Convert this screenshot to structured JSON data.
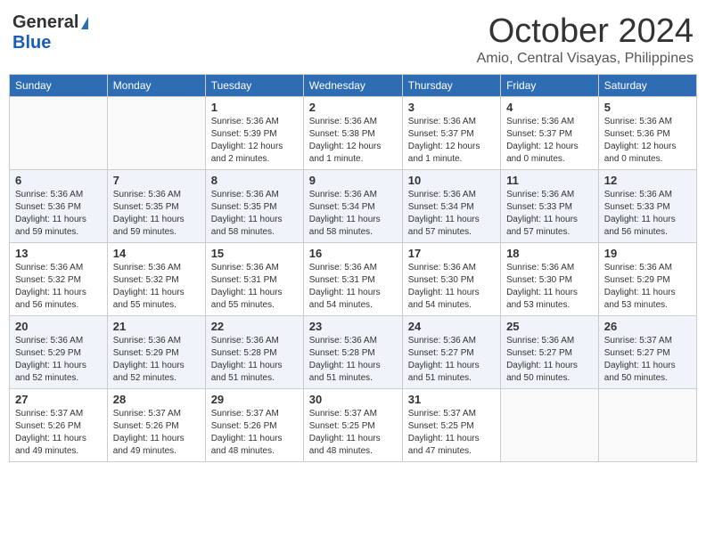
{
  "header": {
    "logo_general": "General",
    "logo_blue": "Blue",
    "month": "October 2024",
    "location": "Amio, Central Visayas, Philippines"
  },
  "days_of_week": [
    "Sunday",
    "Monday",
    "Tuesday",
    "Wednesday",
    "Thursday",
    "Friday",
    "Saturday"
  ],
  "weeks": [
    [
      {
        "day": "",
        "sunrise": "",
        "sunset": "",
        "daylight": ""
      },
      {
        "day": "",
        "sunrise": "",
        "sunset": "",
        "daylight": ""
      },
      {
        "day": "1",
        "sunrise": "Sunrise: 5:36 AM",
        "sunset": "Sunset: 5:39 PM",
        "daylight": "Daylight: 12 hours and 2 minutes."
      },
      {
        "day": "2",
        "sunrise": "Sunrise: 5:36 AM",
        "sunset": "Sunset: 5:38 PM",
        "daylight": "Daylight: 12 hours and 1 minute."
      },
      {
        "day": "3",
        "sunrise": "Sunrise: 5:36 AM",
        "sunset": "Sunset: 5:37 PM",
        "daylight": "Daylight: 12 hours and 1 minute."
      },
      {
        "day": "4",
        "sunrise": "Sunrise: 5:36 AM",
        "sunset": "Sunset: 5:37 PM",
        "daylight": "Daylight: 12 hours and 0 minutes."
      },
      {
        "day": "5",
        "sunrise": "Sunrise: 5:36 AM",
        "sunset": "Sunset: 5:36 PM",
        "daylight": "Daylight: 12 hours and 0 minutes."
      }
    ],
    [
      {
        "day": "6",
        "sunrise": "Sunrise: 5:36 AM",
        "sunset": "Sunset: 5:36 PM",
        "daylight": "Daylight: 11 hours and 59 minutes."
      },
      {
        "day": "7",
        "sunrise": "Sunrise: 5:36 AM",
        "sunset": "Sunset: 5:35 PM",
        "daylight": "Daylight: 11 hours and 59 minutes."
      },
      {
        "day": "8",
        "sunrise": "Sunrise: 5:36 AM",
        "sunset": "Sunset: 5:35 PM",
        "daylight": "Daylight: 11 hours and 58 minutes."
      },
      {
        "day": "9",
        "sunrise": "Sunrise: 5:36 AM",
        "sunset": "Sunset: 5:34 PM",
        "daylight": "Daylight: 11 hours and 58 minutes."
      },
      {
        "day": "10",
        "sunrise": "Sunrise: 5:36 AM",
        "sunset": "Sunset: 5:34 PM",
        "daylight": "Daylight: 11 hours and 57 minutes."
      },
      {
        "day": "11",
        "sunrise": "Sunrise: 5:36 AM",
        "sunset": "Sunset: 5:33 PM",
        "daylight": "Daylight: 11 hours and 57 minutes."
      },
      {
        "day": "12",
        "sunrise": "Sunrise: 5:36 AM",
        "sunset": "Sunset: 5:33 PM",
        "daylight": "Daylight: 11 hours and 56 minutes."
      }
    ],
    [
      {
        "day": "13",
        "sunrise": "Sunrise: 5:36 AM",
        "sunset": "Sunset: 5:32 PM",
        "daylight": "Daylight: 11 hours and 56 minutes."
      },
      {
        "day": "14",
        "sunrise": "Sunrise: 5:36 AM",
        "sunset": "Sunset: 5:32 PM",
        "daylight": "Daylight: 11 hours and 55 minutes."
      },
      {
        "day": "15",
        "sunrise": "Sunrise: 5:36 AM",
        "sunset": "Sunset: 5:31 PM",
        "daylight": "Daylight: 11 hours and 55 minutes."
      },
      {
        "day": "16",
        "sunrise": "Sunrise: 5:36 AM",
        "sunset": "Sunset: 5:31 PM",
        "daylight": "Daylight: 11 hours and 54 minutes."
      },
      {
        "day": "17",
        "sunrise": "Sunrise: 5:36 AM",
        "sunset": "Sunset: 5:30 PM",
        "daylight": "Daylight: 11 hours and 54 minutes."
      },
      {
        "day": "18",
        "sunrise": "Sunrise: 5:36 AM",
        "sunset": "Sunset: 5:30 PM",
        "daylight": "Daylight: 11 hours and 53 minutes."
      },
      {
        "day": "19",
        "sunrise": "Sunrise: 5:36 AM",
        "sunset": "Sunset: 5:29 PM",
        "daylight": "Daylight: 11 hours and 53 minutes."
      }
    ],
    [
      {
        "day": "20",
        "sunrise": "Sunrise: 5:36 AM",
        "sunset": "Sunset: 5:29 PM",
        "daylight": "Daylight: 11 hours and 52 minutes."
      },
      {
        "day": "21",
        "sunrise": "Sunrise: 5:36 AM",
        "sunset": "Sunset: 5:29 PM",
        "daylight": "Daylight: 11 hours and 52 minutes."
      },
      {
        "day": "22",
        "sunrise": "Sunrise: 5:36 AM",
        "sunset": "Sunset: 5:28 PM",
        "daylight": "Daylight: 11 hours and 51 minutes."
      },
      {
        "day": "23",
        "sunrise": "Sunrise: 5:36 AM",
        "sunset": "Sunset: 5:28 PM",
        "daylight": "Daylight: 11 hours and 51 minutes."
      },
      {
        "day": "24",
        "sunrise": "Sunrise: 5:36 AM",
        "sunset": "Sunset: 5:27 PM",
        "daylight": "Daylight: 11 hours and 51 minutes."
      },
      {
        "day": "25",
        "sunrise": "Sunrise: 5:36 AM",
        "sunset": "Sunset: 5:27 PM",
        "daylight": "Daylight: 11 hours and 50 minutes."
      },
      {
        "day": "26",
        "sunrise": "Sunrise: 5:37 AM",
        "sunset": "Sunset: 5:27 PM",
        "daylight": "Daylight: 11 hours and 50 minutes."
      }
    ],
    [
      {
        "day": "27",
        "sunrise": "Sunrise: 5:37 AM",
        "sunset": "Sunset: 5:26 PM",
        "daylight": "Daylight: 11 hours and 49 minutes."
      },
      {
        "day": "28",
        "sunrise": "Sunrise: 5:37 AM",
        "sunset": "Sunset: 5:26 PM",
        "daylight": "Daylight: 11 hours and 49 minutes."
      },
      {
        "day": "29",
        "sunrise": "Sunrise: 5:37 AM",
        "sunset": "Sunset: 5:26 PM",
        "daylight": "Daylight: 11 hours and 48 minutes."
      },
      {
        "day": "30",
        "sunrise": "Sunrise: 5:37 AM",
        "sunset": "Sunset: 5:25 PM",
        "daylight": "Daylight: 11 hours and 48 minutes."
      },
      {
        "day": "31",
        "sunrise": "Sunrise: 5:37 AM",
        "sunset": "Sunset: 5:25 PM",
        "daylight": "Daylight: 11 hours and 47 minutes."
      },
      {
        "day": "",
        "sunrise": "",
        "sunset": "",
        "daylight": ""
      },
      {
        "day": "",
        "sunrise": "",
        "sunset": "",
        "daylight": ""
      }
    ]
  ]
}
